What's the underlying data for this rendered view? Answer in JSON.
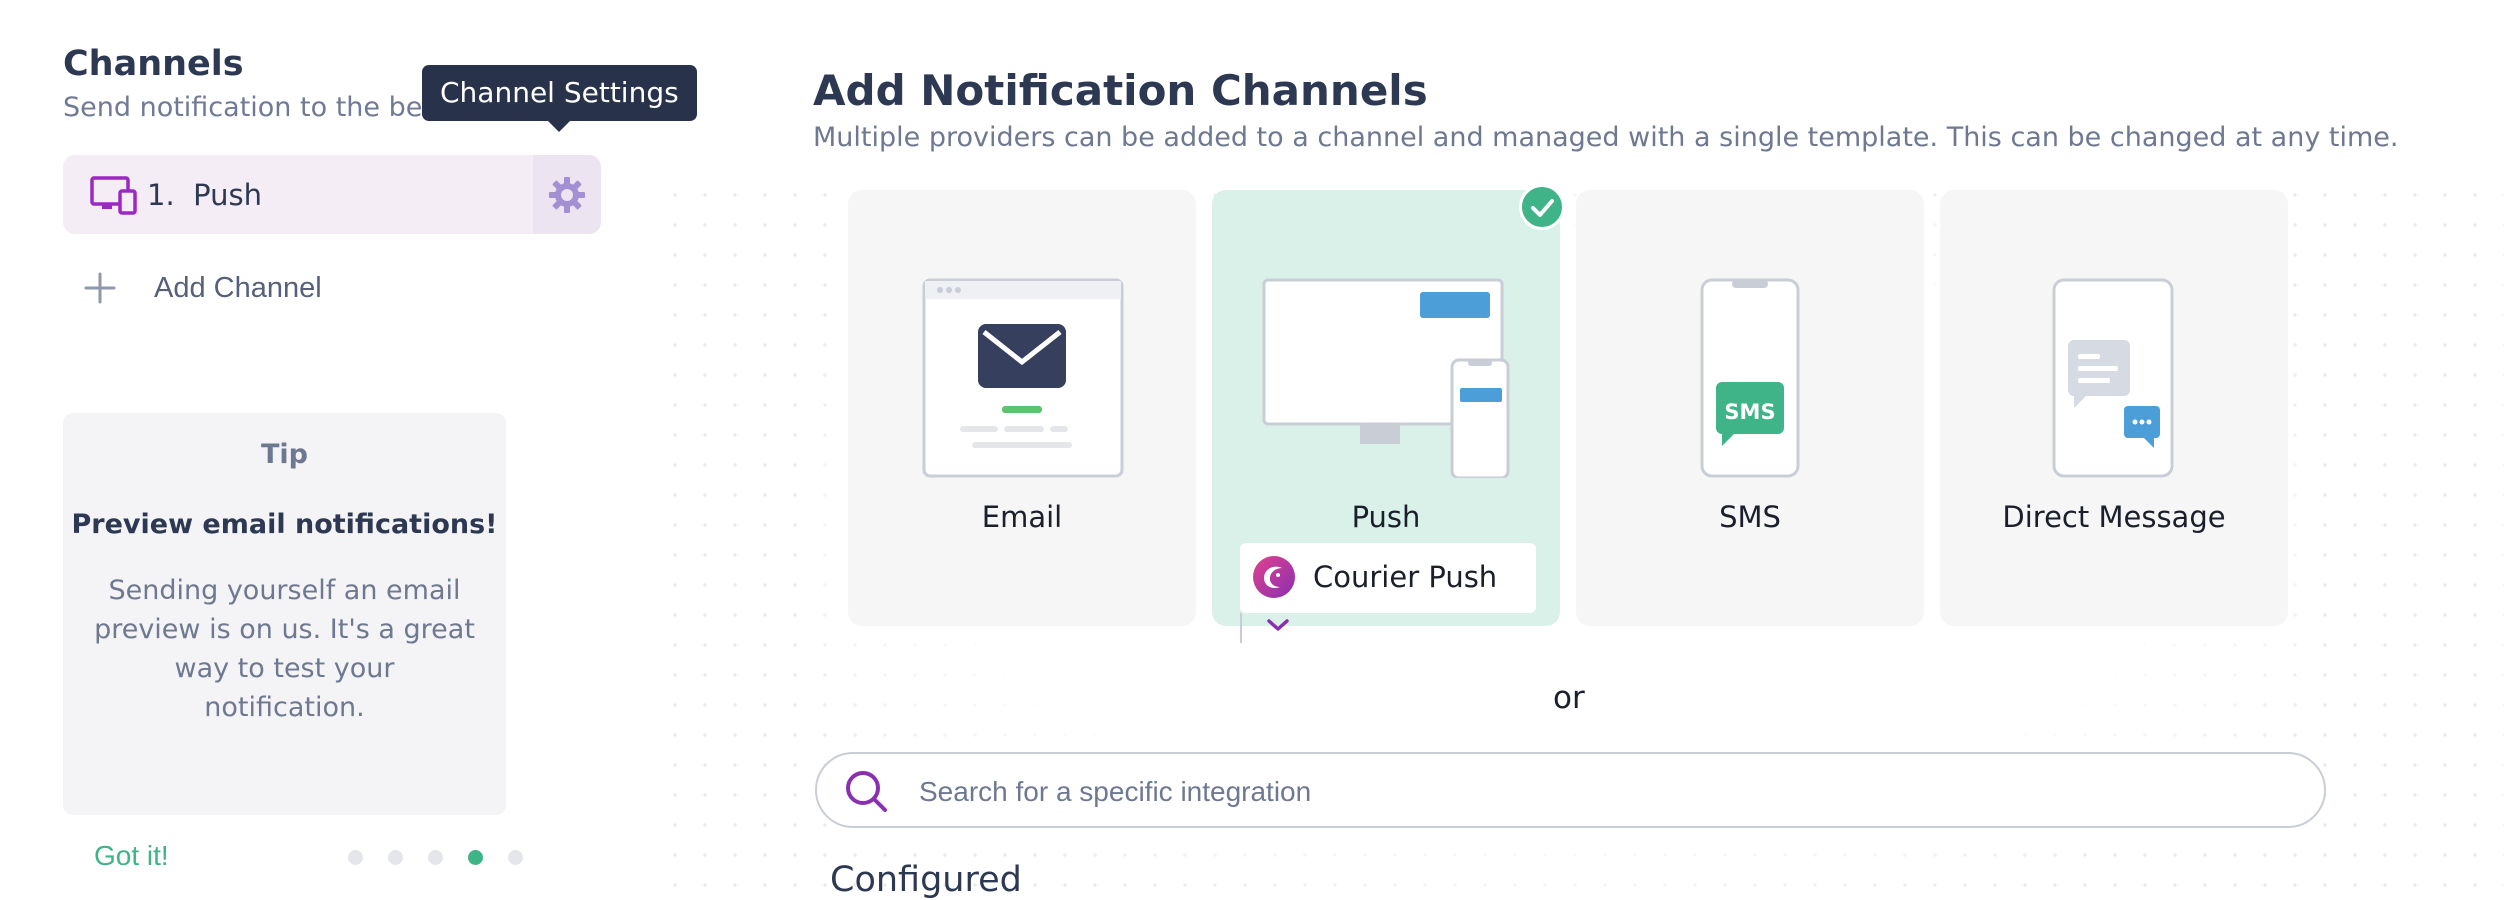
{
  "sidebar": {
    "title": "Channels",
    "subtitle": "Send notification to the best",
    "tooltip": "Channel Settings",
    "channels": [
      {
        "number": "1.",
        "label": "Push",
        "icon": "devices-icon"
      }
    ],
    "add_channel_label": "Add Channel",
    "tip": {
      "title": "Tip",
      "heading": "Preview email notifications!",
      "body": "Sending yourself an email preview is on us. It's a great way to test your notification.",
      "dismiss_label": "Got it!",
      "page_count": 5,
      "active_page": 4
    }
  },
  "main": {
    "title": "Add Notification Channels",
    "subtitle": "Multiple providers can be added to a channel and managed with a single template. This can be changed at any time.",
    "channels": [
      {
        "label": "Email",
        "selected": false
      },
      {
        "label": "Push",
        "selected": true
      },
      {
        "label": "SMS",
        "selected": false
      },
      {
        "label": "Direct Message",
        "selected": false
      }
    ],
    "sms_badge": "SMS",
    "selected_provider": "Courier Push",
    "or_label": "or",
    "search": {
      "placeholder": "Search for a specific integration",
      "value": ""
    },
    "configured_heading": "Configured"
  },
  "colors": {
    "accent_green": "#3fb488",
    "brand_purple": "#9b27c4",
    "navy": "#2d3853",
    "selected_card": "#d9f1e8"
  }
}
